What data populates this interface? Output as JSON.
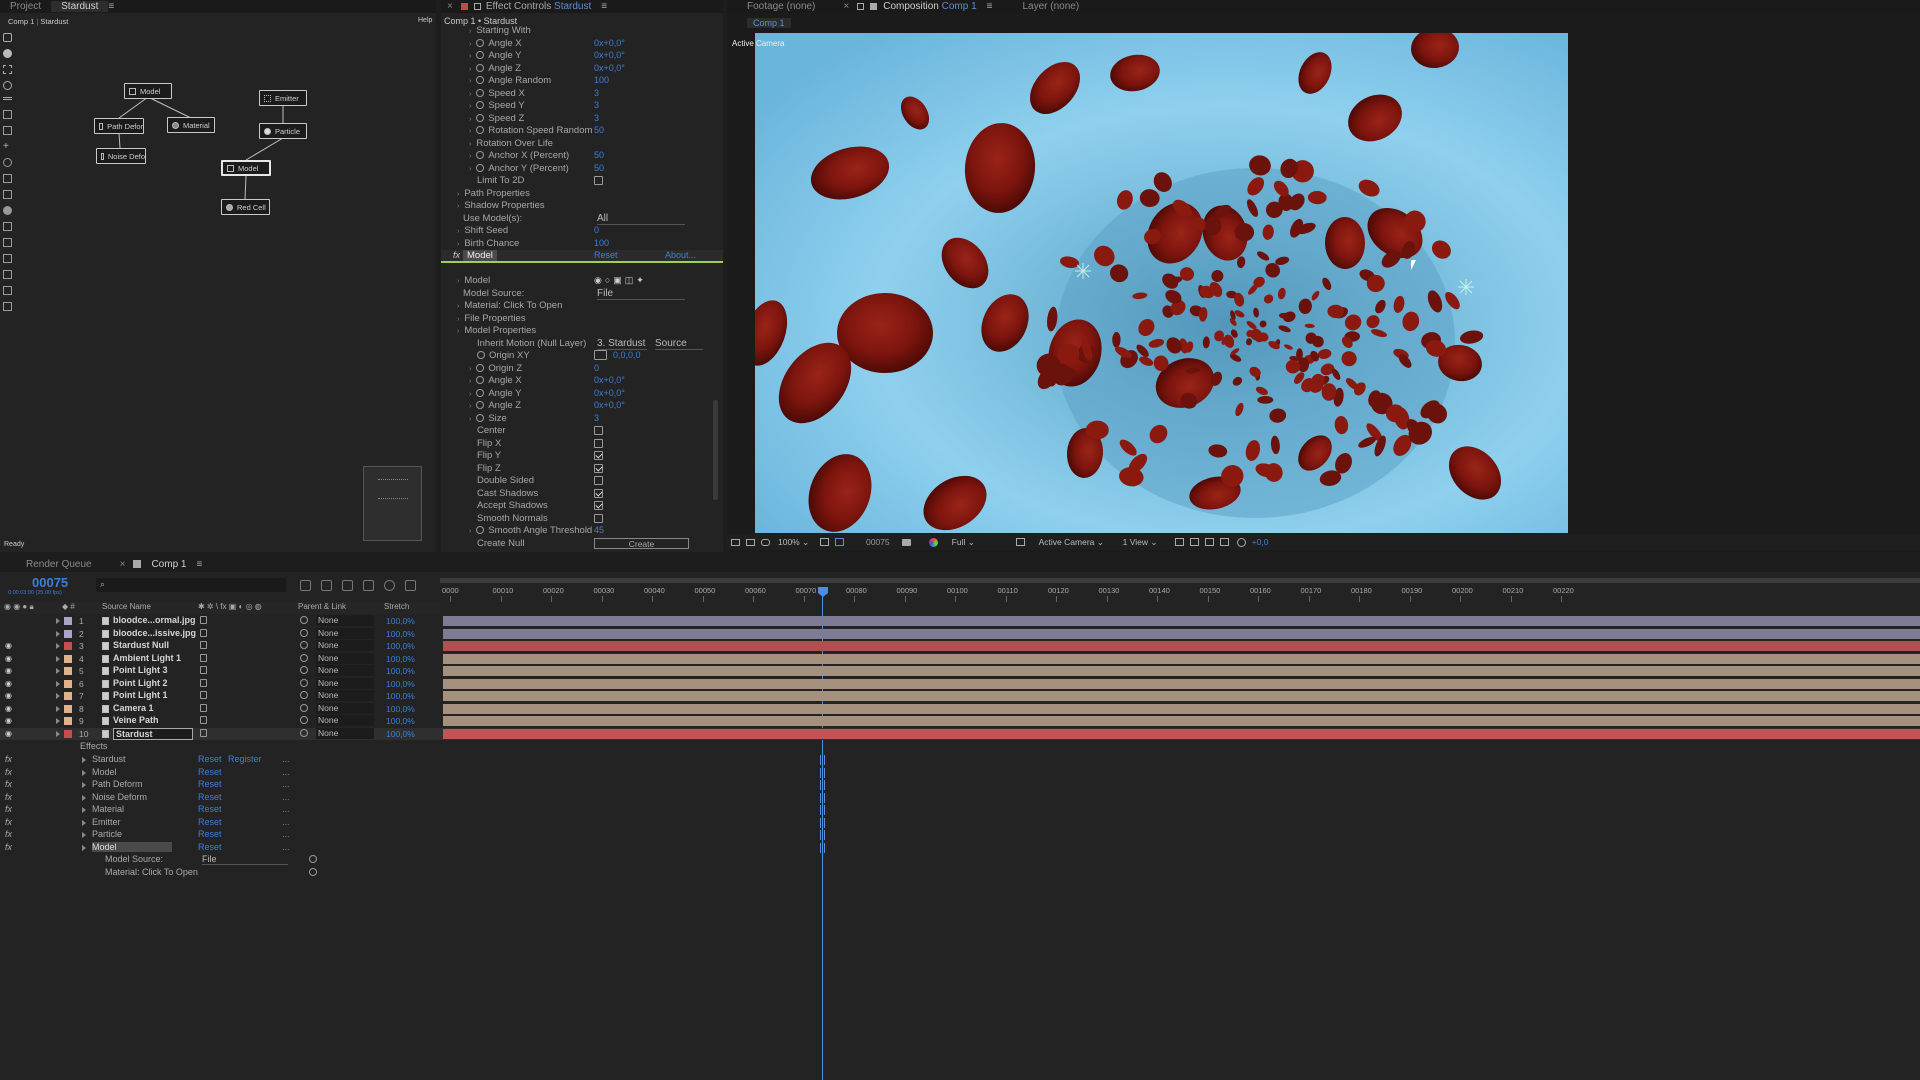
{
  "top_left_tabs": {
    "project": "Project",
    "stardust": "Stardust"
  },
  "node_panel": {
    "breadcrumb_comp": "Comp 1",
    "breadcrumb_layer": "Stardust",
    "help": "Help",
    "status": "Ready",
    "nodes": {
      "model_top": "Model",
      "path_deform": "Path Defor",
      "material": "Material",
      "noise_deform": "Noise Defo",
      "emitter": "Emitter",
      "particle": "Particle",
      "model_mid": "Model",
      "red_cell": "Red Cell"
    }
  },
  "effect_controls": {
    "tab_label": "Effect Controls",
    "tab_layer": "Stardust",
    "header": "Comp 1 • Stardust",
    "rows": [
      {
        "label": "Starting With",
        "indent": 1,
        "type": "group"
      },
      {
        "label": "Angle X",
        "value": "0x+0,0°",
        "type": "prop"
      },
      {
        "label": "Angle Y",
        "value": "0x+0,0°",
        "type": "prop"
      },
      {
        "label": "Angle Z",
        "value": "0x+0,0°",
        "type": "prop"
      },
      {
        "label": "Angle Random",
        "value": "100",
        "type": "prop"
      },
      {
        "label": "Speed X",
        "value": "3",
        "type": "prop"
      },
      {
        "label": "Speed Y",
        "value": "3",
        "type": "prop"
      },
      {
        "label": "Speed Z",
        "value": "3",
        "type": "prop"
      },
      {
        "label": "Rotation Speed Random",
        "value": "50",
        "type": "prop"
      },
      {
        "label": "Rotation Over Life",
        "type": "group"
      },
      {
        "label": "Anchor X (Percent)",
        "value": "50",
        "type": "prop"
      },
      {
        "label": "Anchor Y (Percent)",
        "value": "50",
        "type": "prop"
      },
      {
        "label": "Limit To 2D",
        "type": "check",
        "checked": false
      }
    ],
    "path_properties": "Path Properties",
    "shadow_properties": "Shadow Properties",
    "use_models_label": "Use Model(s):",
    "use_models_value": "All",
    "shift_seed_label": "Shift Seed",
    "shift_seed_value": "0",
    "birth_chance_label": "Birth Chance",
    "birth_chance_value": "100",
    "fx_model_label": "Model",
    "fx_reset": "Reset",
    "fx_about": "About...",
    "model_header": "Model",
    "model_source_label": "Model Source:",
    "model_source_value": "File",
    "material_label": "Material: Click To Open",
    "file_properties": "File Properties",
    "model_properties": "Model Properties",
    "inherit_motion_label": "Inherit Motion (Null Layer)",
    "inherit_motion_value": "3. Stardust",
    "inherit_source": "Source",
    "origin_xy_label": "Origin XY",
    "origin_xy_value": "0,0,0,0",
    "model_rows": [
      {
        "label": "Origin Z",
        "value": "0"
      },
      {
        "label": "Angle X",
        "value": "0x+0,0°"
      },
      {
        "label": "Angle Y",
        "value": "0x+0,0°"
      },
      {
        "label": "Angle Z",
        "value": "0x+0,0°"
      },
      {
        "label": "Size",
        "value": "3"
      }
    ],
    "checks": [
      {
        "label": "Center",
        "checked": false
      },
      {
        "label": "Flip X",
        "checked": false
      },
      {
        "label": "Flip Y",
        "checked": true
      },
      {
        "label": "Flip Z",
        "checked": true
      },
      {
        "label": "Double Sided",
        "checked": false
      },
      {
        "label": "Cast Shadows",
        "checked": true
      },
      {
        "label": "Accept Shadows",
        "checked": true
      },
      {
        "label": "Smooth Normals",
        "checked": false
      }
    ],
    "smooth_angle_label": "Smooth Angle Threshold",
    "smooth_angle_value": "45",
    "create_null_label": "Create Null",
    "create_button": "Create"
  },
  "viewer": {
    "footage_tab": "Footage",
    "footage_value": "(none)",
    "composition_tab": "Composition",
    "composition_value": "Comp 1",
    "layer_tab": "Layer",
    "layer_value": "(none)",
    "comp_subtab": "Comp 1",
    "active_camera_label": "Active Camera",
    "zoom": "100%",
    "frame": "00075",
    "resolution": "Full",
    "camera": "Active Camera",
    "views": "1 View",
    "exposure": "+0,0"
  },
  "timeline": {
    "render_queue_tab": "Render Queue",
    "comp_tab": "Comp 1",
    "timecode": "00075",
    "timecode_sub": "0:00:03:00 (25.00 fps)",
    "columns": {
      "source_name": "Source Name",
      "parent_link": "Parent & Link",
      "stretch": "Stretch"
    },
    "ruler": [
      "0000",
      "00010",
      "00020",
      "00030",
      "00040",
      "00050",
      "00060",
      "00070",
      "00080",
      "00090",
      "00100",
      "00110",
      "00120",
      "00130",
      "00140",
      "00150",
      "00160",
      "00170",
      "00180",
      "00190",
      "00200",
      "00210",
      "00220"
    ],
    "layers": [
      {
        "num": "1",
        "name": "bloodce...ormal.jpg",
        "color": "#a7a6c6",
        "eye": false,
        "track": "#7e7b94",
        "parent": "None",
        "stretch": "100,0%"
      },
      {
        "num": "2",
        "name": "bloodce...issive.jpg",
        "color": "#a7a6c6",
        "eye": false,
        "track": "#7e7b94",
        "parent": "None",
        "stretch": "100,0%"
      },
      {
        "num": "3",
        "name": "Stardust Null",
        "color": "#c74e4e",
        "eye": true,
        "track": "#b05050",
        "parent": "None",
        "stretch": "100,0%"
      },
      {
        "num": "4",
        "name": "Ambient Light 1",
        "color": "#e0b28c",
        "eye": true,
        "track": "#a6917e",
        "parent": "None",
        "stretch": "100,0%"
      },
      {
        "num": "5",
        "name": "Point Light 3",
        "color": "#e0b28c",
        "eye": true,
        "track": "#a6917e",
        "parent": "None",
        "stretch": "100,0%"
      },
      {
        "num": "6",
        "name": "Point Light 2",
        "color": "#e0b28c",
        "eye": true,
        "track": "#a6917e",
        "parent": "None",
        "stretch": "100,0%"
      },
      {
        "num": "7",
        "name": "Point Light 1",
        "color": "#e0b28c",
        "eye": true,
        "track": "#a6917e",
        "parent": "None",
        "stretch": "100,0%"
      },
      {
        "num": "8",
        "name": "Camera 1",
        "color": "#e0b28c",
        "eye": true,
        "track": "#a6917e",
        "parent": "None",
        "stretch": "100,0%"
      },
      {
        "num": "9",
        "name": "Veine Path",
        "color": "#e0b28c",
        "eye": true,
        "track": "#a6917e",
        "parent": "None",
        "stretch": "100,0%"
      },
      {
        "num": "10",
        "name": "Stardust",
        "color": "#c74e4e",
        "eye": true,
        "track": "#c05555",
        "parent": "None",
        "stretch": "100,0%"
      }
    ],
    "effects_label": "Effects",
    "effects": [
      {
        "name": "Stardust",
        "reset": "Reset",
        "extra": "Register"
      },
      {
        "name": "Model",
        "reset": "Reset"
      },
      {
        "name": "Path Deform",
        "reset": "Reset"
      },
      {
        "name": "Noise Deform",
        "reset": "Reset"
      },
      {
        "name": "Material",
        "reset": "Reset"
      },
      {
        "name": "Emitter",
        "reset": "Reset"
      },
      {
        "name": "Particle",
        "reset": "Reset"
      },
      {
        "name": "Model",
        "reset": "Reset"
      }
    ],
    "model_source_label": "Model Source:",
    "model_source_value": "File",
    "material_label": "Material: Click To Open"
  },
  "colors": {
    "accent": "#3c7fd8",
    "playhead": "#4a90e2",
    "bg_panel": "#232323",
    "vessel": "#6fb6d8"
  }
}
